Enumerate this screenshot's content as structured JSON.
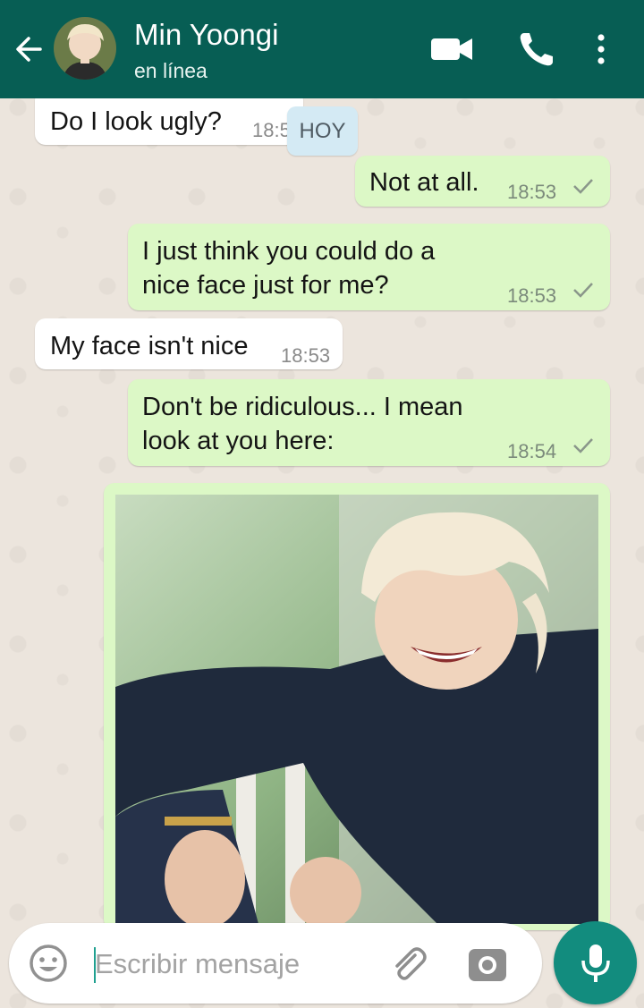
{
  "header": {
    "contact_name": "Min Yoongi",
    "status": "en línea",
    "back_icon": "arrow-back-icon",
    "video_icon": "videocam-icon",
    "call_icon": "phone-icon",
    "menu_icon": "more-vert-icon"
  },
  "date_chip": "HOY",
  "messages": [
    {
      "direction": "incoming",
      "text": "Do I look ugly?",
      "time": "18:5"
    },
    {
      "direction": "outgoing",
      "text": "Not at all.",
      "time": "18:53",
      "status": "sent"
    },
    {
      "direction": "outgoing",
      "lines": [
        "I just think you could do a",
        "nice face just for me?"
      ],
      "time": "18:53",
      "status": "sent"
    },
    {
      "direction": "incoming",
      "text": "My face isn't nice",
      "time": "18:53"
    },
    {
      "direction": "outgoing",
      "lines": [
        "Don't be ridiculous... I mean",
        "look at you here:"
      ],
      "time": "18:54",
      "status": "sent"
    },
    {
      "direction": "outgoing",
      "type": "image",
      "image": "photo of smiling blond man leaning on white railing"
    }
  ],
  "composer": {
    "placeholder": "Escribir mensaje",
    "emoji_icon": "emoji-icon",
    "attach_icon": "paperclip-icon",
    "camera_icon": "camera-icon",
    "mic_icon": "mic-icon"
  },
  "colors": {
    "header": "#075e54",
    "outgoing_bubble": "#dcf8c6",
    "incoming_bubble": "#ffffff",
    "wallpaper": "#ece5dd",
    "mic_button": "#128c7e"
  }
}
